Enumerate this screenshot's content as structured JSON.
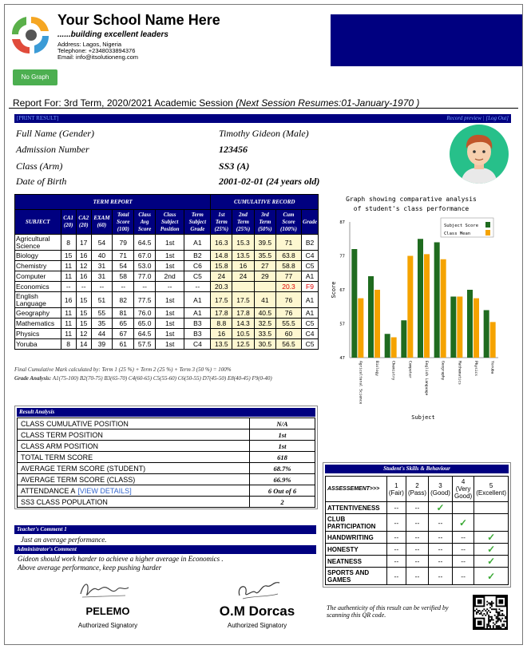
{
  "header": {
    "school_name": "Your School Name Here",
    "motto": "......building excellent leaders",
    "address": "Address: Lagos, Nigeria",
    "telephone": "Telephone: +2348033894376",
    "email": "Email: info@itsolutioneng.com"
  },
  "buttons": {
    "no_graph": "No Graph"
  },
  "report": {
    "prefix": "Report For: 3rd Term, 2020/2021 Academic Session",
    "next_session": "(Next Session Resumes:01-January-1970 )"
  },
  "links": {
    "print_result": "[PRINT RESULT]",
    "record_preview": "Record preview",
    "log_out": "[Log Out]"
  },
  "bio": {
    "labels": [
      "Full Name (Gender)",
      "Admission Number",
      "Class (Arm)",
      "Date of Birth"
    ],
    "values": [
      "Timothy Gideon (Male)",
      "123456",
      "SS3 (A)",
      "2001-02-01 (24 years old)"
    ]
  },
  "grades": {
    "group_headers": [
      "TERM REPORT",
      "CUMULATIVE RECORD"
    ],
    "headers": [
      "SUBJECT",
      "CA1 (20)",
      "CA2 (20)",
      "EXAM (60)",
      "Total Score (100)",
      "Class Avg Score",
      "Class Subject Position",
      "Term Subject Grade",
      "1st Term (25%)",
      "2nd Term (25%)",
      "3rd Term (50%)",
      "Cum Score (100%)",
      "Grade"
    ],
    "rows": [
      [
        "Agricultural Science",
        "8",
        "17",
        "54",
        "79",
        "64.5",
        "1st",
        "A1",
        "16.3",
        "15.3",
        "39.5",
        "71",
        "B2"
      ],
      [
        "Biology",
        "15",
        "16",
        "40",
        "71",
        "67.0",
        "1st",
        "B2",
        "14.8",
        "13.5",
        "35.5",
        "63.8",
        "C4"
      ],
      [
        "Chemistry",
        "11",
        "12",
        "31",
        "54",
        "53.0",
        "1st",
        "C6",
        "15.8",
        "16",
        "27",
        "58.8",
        "C5"
      ],
      [
        "Computer",
        "11",
        "16",
        "31",
        "58",
        "77.0",
        "2nd",
        "C5",
        "24",
        "24",
        "29",
        "77",
        "A1"
      ],
      [
        "Economics",
        "--",
        "--",
        "--",
        "--",
        "--",
        "--",
        "--",
        "20.3",
        "",
        "",
        "20.3",
        "F9"
      ],
      [
        "English Language",
        "16",
        "15",
        "51",
        "82",
        "77.5",
        "1st",
        "A1",
        "17.5",
        "17.5",
        "41",
        "76",
        "A1"
      ],
      [
        "Geography",
        "11",
        "15",
        "55",
        "81",
        "76.0",
        "1st",
        "A1",
        "17.8",
        "17.8",
        "40.5",
        "76",
        "A1"
      ],
      [
        "Mathematics",
        "11",
        "15",
        "35",
        "65",
        "65.0",
        "1st",
        "B3",
        "8.8",
        "14.3",
        "32.5",
        "55.5",
        "C5"
      ],
      [
        "Physics",
        "11",
        "12",
        "44",
        "67",
        "64.5",
        "1st",
        "B3",
        "16",
        "10.5",
        "33.5",
        "60",
        "C4"
      ],
      [
        "Yoruba",
        "8",
        "14",
        "39",
        "61",
        "57.5",
        "1st",
        "C4",
        "13.5",
        "12.5",
        "30.5",
        "56.5",
        "C5"
      ]
    ],
    "failing_color": "#e00000",
    "final_note": "Final Cumulative Mark calculated by: Term 1 (25 %) + Term 2 (25 %) + Term 3 (50 %) = 100%",
    "grade_analysis_label": "Grade Analysis:",
    "grade_analysis": "A1(75-100) B2(70-75) B3(65-70) C4(60-65) C5(55-60) C6(50-55) D7(45-50) E8(40-45) F9(0-40)"
  },
  "chart_data": {
    "type": "bar",
    "title": "Graph showing comparative analysis of student's class performance",
    "xlabel": "Subject",
    "ylabel": "Score",
    "categories": [
      "Agricultural Science",
      "Biology",
      "Chemistry",
      "Computer",
      "English Language",
      "Geography",
      "Mathematics",
      "Physics",
      "Yoruba"
    ],
    "series": [
      {
        "name": "Subject Score",
        "color": "#1f6b1f",
        "values": [
          79,
          71,
          54,
          58,
          82,
          81,
          65,
          67,
          61
        ]
      },
      {
        "name": "Class Mean",
        "color": "#f5a300",
        "values": [
          64.5,
          67.0,
          53.0,
          77.0,
          77.5,
          76.0,
          65.0,
          64.5,
          57.5
        ]
      }
    ],
    "yticks": [
      47,
      57,
      67,
      77,
      87
    ],
    "ylim": [
      47,
      87
    ],
    "legend": "top-right"
  },
  "result_analysis": {
    "title": "Result Analysis",
    "rows": [
      [
        "CLASS CUMULATIVE POSITION",
        "N/A"
      ],
      [
        "CLASS TERM POSITION",
        "1st"
      ],
      [
        "CLASS ARM POSITION",
        "1st"
      ],
      [
        "TOTAL TERM SCORE",
        "618"
      ],
      [
        "AVERAGE TERM SCORE (STUDENT)",
        "68.7%"
      ],
      [
        "AVERAGE TERM SCORE (CLASS)",
        "66.9%"
      ],
      [
        "ATTENDANCE A",
        "6 Out of 6"
      ],
      [
        "SS3 CLASS POPULATION",
        "2"
      ]
    ],
    "view_details": "[VIEW DETAILS]"
  },
  "comments": {
    "teacher_title": "Teacher's Comment 1",
    "teacher": "Just an average performance.",
    "admin_title": "Administrator's Comment",
    "admin_1": "Gideon should work harder to achieve a higher average in Economics .",
    "admin_2": "Above average performance, keep pushing harder"
  },
  "skills": {
    "title": "Student's Skills & Behaviour",
    "assessment_label": "ASSESSEMENT>>>",
    "scale": [
      "1 (Fair)",
      "2 (Pass)",
      "3 (Good)",
      "4 (Very Good)",
      "5 (Excellent)"
    ],
    "rows": [
      {
        "label": "ATTENTIVENESS",
        "rating": 3
      },
      {
        "label": "CLUB PARTICIPATION",
        "rating": 4
      },
      {
        "label": "HANDWRITING",
        "rating": 5
      },
      {
        "label": "HONESTY",
        "rating": 5
      },
      {
        "label": "NEATNESS",
        "rating": 5
      },
      {
        "label": "SPORTS AND GAMES",
        "rating": 5
      }
    ]
  },
  "signatories": [
    {
      "name": "PELEMO",
      "title": "Authorized Signatory"
    },
    {
      "name": "O.M Dorcas",
      "title": "Authorized Signatory"
    }
  ],
  "authenticity": "The authenticity of this result can be verified by scanning this QR code."
}
